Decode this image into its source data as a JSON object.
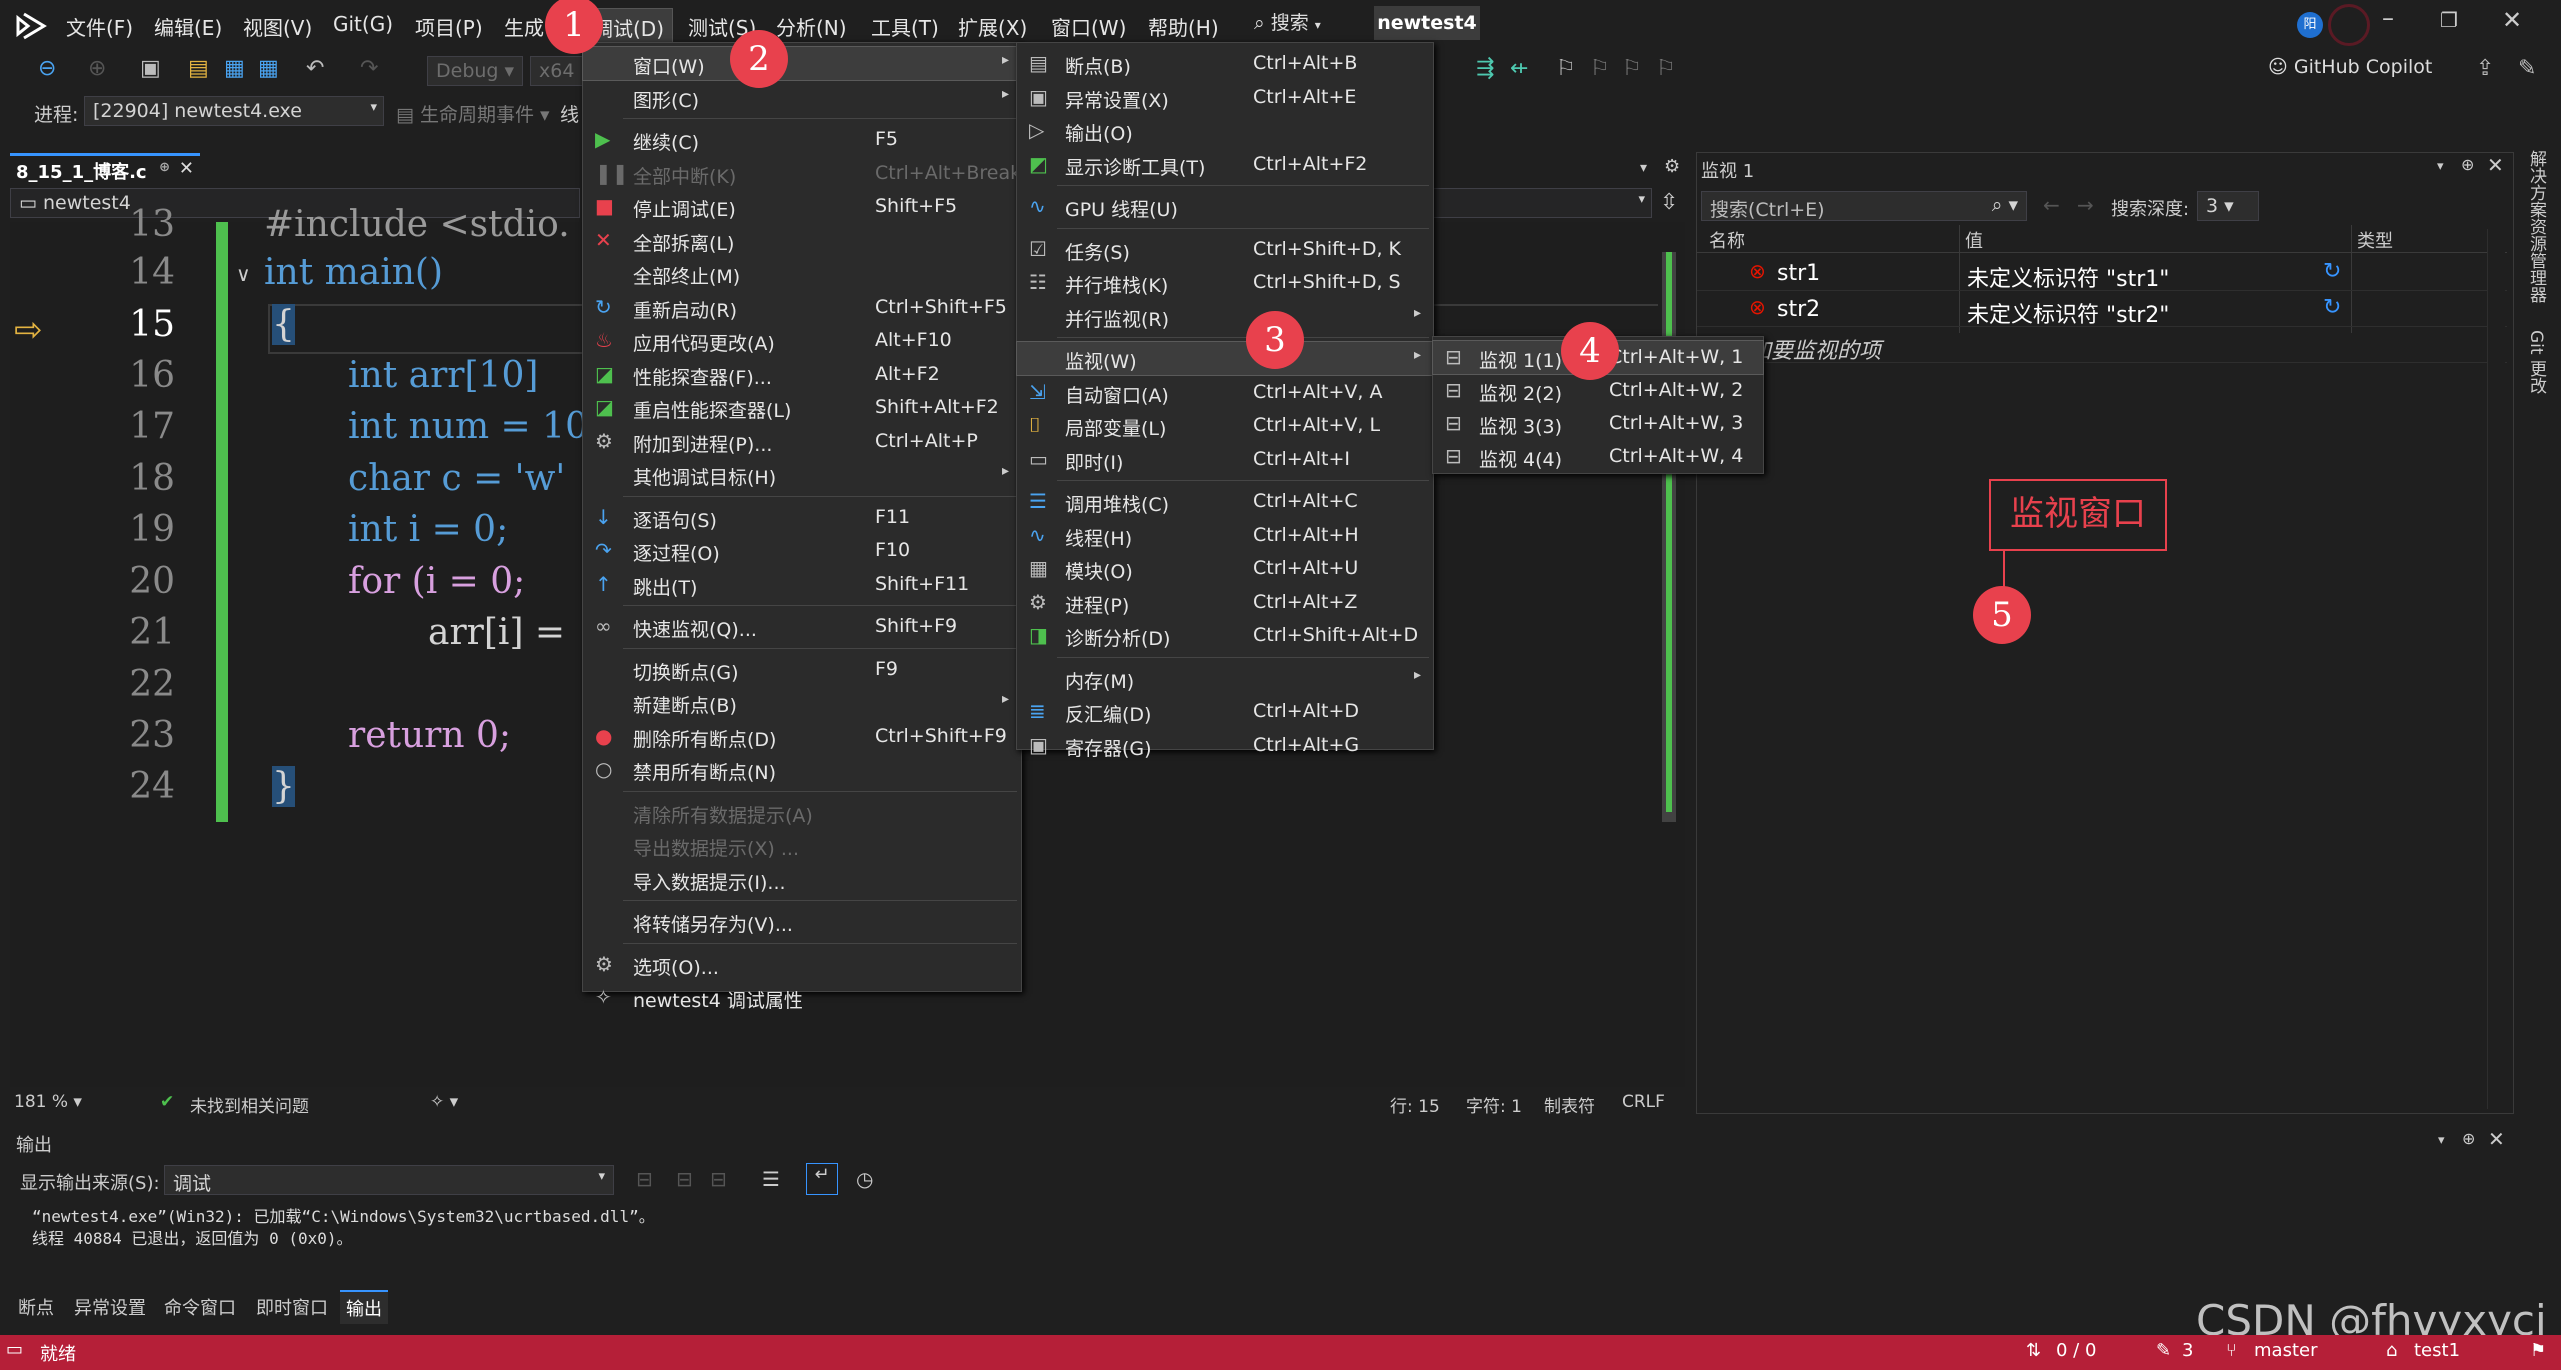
{
  "titlebar": {
    "menus": [
      "文件(F)",
      "编辑(E)",
      "视图(V)",
      "Git(G)",
      "项目(P)",
      "生成",
      "调试(D)",
      "测试(S)",
      "分析(N)",
      "工具(T)",
      "扩展(X)",
      "窗口(W)",
      "帮助(H)"
    ],
    "search_label": "搜索",
    "solution_name": "newtest4",
    "avatar_initial": "阳",
    "copilot_label": "GitHub Copilot"
  },
  "toolbar": {
    "config": "Debug",
    "platform": "x64",
    "process_label": "进程:",
    "process_value": "[22904] newtest4.exe",
    "lifecycle_label": "生命周期事件",
    "thread_label": "线"
  },
  "editor": {
    "tab_title": "8_15_1_博客.c",
    "scope": "newtest4",
    "lines": [
      {
        "num": "13",
        "text": "#include <stdio."
      },
      {
        "num": "14",
        "text": "int main()"
      },
      {
        "num": "15",
        "text": "{"
      },
      {
        "num": "16",
        "text": "int arr[10]"
      },
      {
        "num": "17",
        "text": "int num = 10"
      },
      {
        "num": "18",
        "text": "char c = 'w'"
      },
      {
        "num": "19",
        "text": "int i = 0;"
      },
      {
        "num": "20",
        "text": "for (i = 0;"
      },
      {
        "num": "21",
        "text": "arr[i] ="
      },
      {
        "num": "22",
        "text": ""
      },
      {
        "num": "23",
        "text": "return 0;"
      },
      {
        "num": "24",
        "text": "}"
      }
    ],
    "zoom": "181 %",
    "issues": "未找到相关问题",
    "row": "行: 15",
    "col": "字符: 1",
    "indent": "制表符",
    "eol": "CRLF"
  },
  "debug_menu": [
    {
      "label": "窗口(W)",
      "shortcut": "",
      "icon": "",
      "submenu": true,
      "highlight": true
    },
    {
      "label": "图形(C)",
      "shortcut": "",
      "icon": "",
      "submenu": true
    },
    {
      "sep": true
    },
    {
      "label": "继续(C)",
      "shortcut": "F5",
      "icon": "play-icon"
    },
    {
      "label": "全部中断(K)",
      "shortcut": "Ctrl+Alt+Break",
      "icon": "pause-icon",
      "disabled": true
    },
    {
      "label": "停止调试(E)",
      "shortcut": "Shift+F5",
      "icon": "stop-icon"
    },
    {
      "label": "全部拆离(L)",
      "shortcut": "",
      "icon": "close-icon"
    },
    {
      "label": "全部终止(M)",
      "shortcut": "",
      "icon": ""
    },
    {
      "label": "重新启动(R)",
      "shortcut": "Ctrl+Shift+F5",
      "icon": "restart-icon"
    },
    {
      "label": "应用代码更改(A)",
      "shortcut": "Alt+F10",
      "icon": "hot-reload-icon"
    },
    {
      "label": "性能探查器(F)...",
      "shortcut": "Alt+F2",
      "icon": "profiler-icon"
    },
    {
      "label": "重启性能探查器(L)",
      "shortcut": "Shift+Alt+F2",
      "icon": "profiler-icon"
    },
    {
      "label": "附加到进程(P)...",
      "shortcut": "Ctrl+Alt+P",
      "icon": "attach-icon"
    },
    {
      "label": "其他调试目标(H)",
      "shortcut": "",
      "icon": "",
      "submenu": true
    },
    {
      "sep": true
    },
    {
      "label": "逐语句(S)",
      "shortcut": "F11",
      "icon": "step-into-icon"
    },
    {
      "label": "逐过程(O)",
      "shortcut": "F10",
      "icon": "step-over-icon"
    },
    {
      "label": "跳出(T)",
      "shortcut": "Shift+F11",
      "icon": "step-out-icon"
    },
    {
      "sep": true
    },
    {
      "label": "快速监视(Q)...",
      "shortcut": "Shift+F9",
      "icon": "glasses-icon"
    },
    {
      "sep": true
    },
    {
      "label": "切换断点(G)",
      "shortcut": "F9",
      "icon": ""
    },
    {
      "label": "新建断点(B)",
      "shortcut": "",
      "icon": "",
      "submenu": true
    },
    {
      "label": "删除所有断点(D)",
      "shortcut": "Ctrl+Shift+F9",
      "icon": "delete-breakpoints-icon"
    },
    {
      "label": "禁用所有断点(N)",
      "shortcut": "",
      "icon": "disable-breakpoints-icon"
    },
    {
      "sep": true
    },
    {
      "label": "清除所有数据提示(A)",
      "shortcut": "",
      "icon": "",
      "disabled": true
    },
    {
      "label": "导出数据提示(X) ...",
      "shortcut": "",
      "icon": "",
      "disabled": true
    },
    {
      "label": "导入数据提示(I)...",
      "shortcut": "",
      "icon": ""
    },
    {
      "sep": true
    },
    {
      "label": "将转储另存为(V)...",
      "shortcut": "",
      "icon": ""
    },
    {
      "sep": true
    },
    {
      "label": "选项(O)...",
      "shortcut": "",
      "icon": "gear-icon"
    },
    {
      "label": "newtest4 调试属性",
      "shortcut": "",
      "icon": "wrench-icon"
    }
  ],
  "window_menu": [
    {
      "label": "断点(B)",
      "shortcut": "Ctrl+Alt+B",
      "icon": "breakpoints-icon"
    },
    {
      "label": "异常设置(X)",
      "shortcut": "Ctrl+Alt+E",
      "icon": "exception-icon"
    },
    {
      "label": "输出(O)",
      "shortcut": "",
      "icon": "output-icon"
    },
    {
      "label": "显示诊断工具(T)",
      "shortcut": "Ctrl+Alt+F2",
      "icon": "diagnostics-icon"
    },
    {
      "sep": true
    },
    {
      "label": "GPU 线程(U)",
      "shortcut": "",
      "icon": "gpu-icon"
    },
    {
      "sep": true
    },
    {
      "label": "任务(S)",
      "shortcut": "Ctrl+Shift+D, K",
      "icon": "tasks-icon"
    },
    {
      "label": "并行堆栈(K)",
      "shortcut": "Ctrl+Shift+D, S",
      "icon": "parallel-stacks-icon"
    },
    {
      "label": "并行监视(R)",
      "shortcut": "",
      "icon": "",
      "submenu": true
    },
    {
      "sep": true
    },
    {
      "label": "监视(W)",
      "shortcut": "",
      "icon": "",
      "submenu": true,
      "highlight": true
    },
    {
      "label": "自动窗口(A)",
      "shortcut": "Ctrl+Alt+V, A",
      "icon": "autos-icon"
    },
    {
      "label": "局部变量(L)",
      "shortcut": "Ctrl+Alt+V, L",
      "icon": "locals-icon"
    },
    {
      "label": "即时(I)",
      "shortcut": "Ctrl+Alt+I",
      "icon": "immediate-icon"
    },
    {
      "sep": true
    },
    {
      "label": "调用堆栈(C)",
      "shortcut": "Ctrl+Alt+C",
      "icon": "call-stack-icon"
    },
    {
      "label": "线程(H)",
      "shortcut": "Ctrl+Alt+H",
      "icon": "threads-icon"
    },
    {
      "label": "模块(O)",
      "shortcut": "Ctrl+Alt+U",
      "icon": "modules-icon"
    },
    {
      "label": "进程(P)",
      "shortcut": "Ctrl+Alt+Z",
      "icon": "processes-icon"
    },
    {
      "label": "诊断分析(D)",
      "shortcut": "Ctrl+Shift+Alt+D",
      "icon": "analysis-icon"
    },
    {
      "sep": true
    },
    {
      "label": "内存(M)",
      "shortcut": "",
      "icon": "",
      "submenu": true
    },
    {
      "label": "反汇编(D)",
      "shortcut": "Ctrl+Alt+D",
      "icon": "disassembly-icon"
    },
    {
      "label": "寄存器(G)",
      "shortcut": "Ctrl+Alt+G",
      "icon": "registers-icon"
    }
  ],
  "watch_submenu": [
    {
      "label": "监视 1(1)",
      "shortcut": "Ctrl+Alt+W, 1",
      "highlight": true
    },
    {
      "label": "监视 2(2)",
      "shortcut": "Ctrl+Alt+W, 2"
    },
    {
      "label": "监视 3(3)",
      "shortcut": "Ctrl+Alt+W, 3"
    },
    {
      "label": "监视 4(4)",
      "shortcut": "Ctrl+Alt+W, 4"
    }
  ],
  "watch_panel": {
    "title": "监视 1",
    "search_placeholder": "搜索(Ctrl+E)",
    "depth_label": "搜索深度:",
    "depth_value": "3",
    "col_name": "名称",
    "col_value": "值",
    "col_type": "类型",
    "rows": [
      {
        "name": "str1",
        "value": "未定义标识符 \"str1\""
      },
      {
        "name": "str2",
        "value": "未定义标识符 \"str2\""
      }
    ],
    "add_item": "添加要监视的项",
    "annotation_label": "监视窗口"
  },
  "badges": [
    "1",
    "2",
    "3",
    "4",
    "5"
  ],
  "output_panel": {
    "title": "输出",
    "source_label": "显示输出来源(S):",
    "source_value": "调试",
    "lines": [
      "“newtest4.exe”(Win32): 已加载“C:\\Windows\\System32\\ucrtbased.dll”。",
      "线程 40884 已退出，返回值为 0 (0x0)。"
    ],
    "tabs": [
      "断点",
      "异常设置",
      "命令窗口",
      "即时窗口",
      "输出"
    ]
  },
  "right_sidebar": [
    "解决方案资源管理器",
    "Git 更改"
  ],
  "statusbar": {
    "ready": "就绪",
    "sync": "0 / 0",
    "pencil_count": "3",
    "branch": "master",
    "repo": "test1"
  },
  "watermark": "CSDN @fhvyxyci",
  "colors": {
    "accent": "#3794ff",
    "badge": "#e8414d",
    "status": "#b51f38",
    "error": "#e51400"
  }
}
